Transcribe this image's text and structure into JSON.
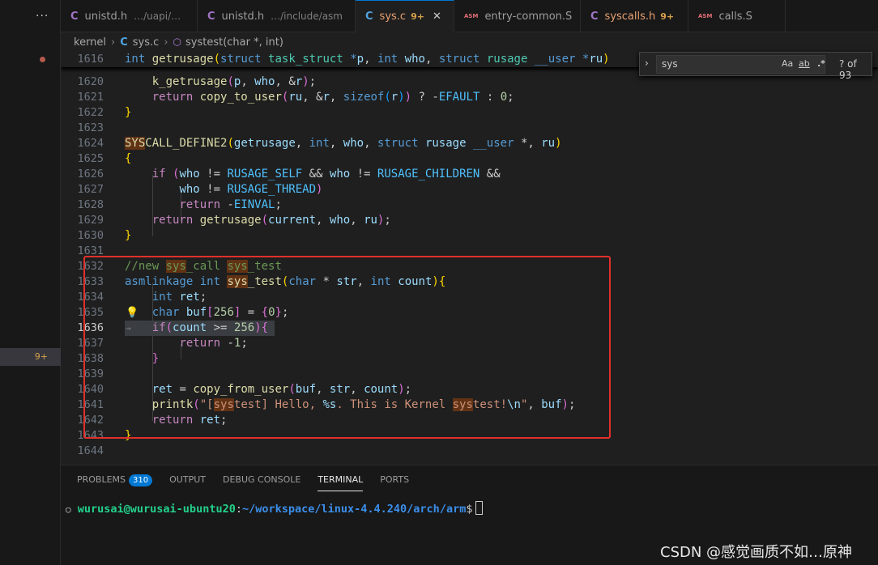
{
  "colors": {
    "accent": "#0078d4",
    "highlight_box": "#e0302b",
    "warning": "#d7a14b"
  },
  "explorer": {
    "more_label": "···",
    "selected_badge": "9+"
  },
  "tabs": [
    {
      "name": "unistd.h",
      "path": "…/uapi/…",
      "icon": "c-icon",
      "modified": "",
      "active": false
    },
    {
      "name": "unistd.h",
      "path": "…/include/asm",
      "icon": "c-icon",
      "modified": "",
      "active": false
    },
    {
      "name": "sys.c",
      "path": "",
      "icon": "c-icon",
      "modified": "9+",
      "active": true
    },
    {
      "name": "entry-common.S",
      "path": "",
      "icon": "asm-icon",
      "modified": "",
      "active": false
    },
    {
      "name": "syscalls.h",
      "path": "",
      "icon": "c-icon",
      "modified": "9+",
      "active": false
    },
    {
      "name": "calls.S",
      "path": "",
      "icon": "asm-icon",
      "modified": "",
      "active": false
    }
  ],
  "tab_icon_labels": {
    "c": "C",
    "asm": "ASM",
    "close": "✕"
  },
  "breadcrumb": {
    "folder": "kernel",
    "file_icon": "C",
    "file": "sys.c",
    "symbol": "systest(char *, int)"
  },
  "find": {
    "query": "sys",
    "match_case": "Aa",
    "whole_word": "ab",
    "regex": ".*",
    "count": "? of 93"
  },
  "editor": {
    "sticky_line": "1616",
    "line_numbers": [
      "1620",
      "1621",
      "1622",
      "1623",
      "1624",
      "1625",
      "1626",
      "1627",
      "1628",
      "1629",
      "1630",
      "1631",
      "1632",
      "1633",
      "1634",
      "1635",
      "1636",
      "1637",
      "1638",
      "1639",
      "1640",
      "1641",
      "1642",
      "1643",
      "1644"
    ],
    "current_line": "1636"
  },
  "panel": {
    "tabs": [
      {
        "label": "PROBLEMS",
        "badge": "310"
      },
      {
        "label": "OUTPUT"
      },
      {
        "label": "DEBUG CONSOLE"
      },
      {
        "label": "TERMINAL",
        "active": true
      },
      {
        "label": "PORTS"
      }
    ],
    "terminal": {
      "user": "wurusai@wurusai-ubuntu20",
      "path": "~/workspace/linux-4.4.240/arch/arm",
      "prompt": "$"
    }
  },
  "watermark": "CSDN @感觉画质不如…原神"
}
